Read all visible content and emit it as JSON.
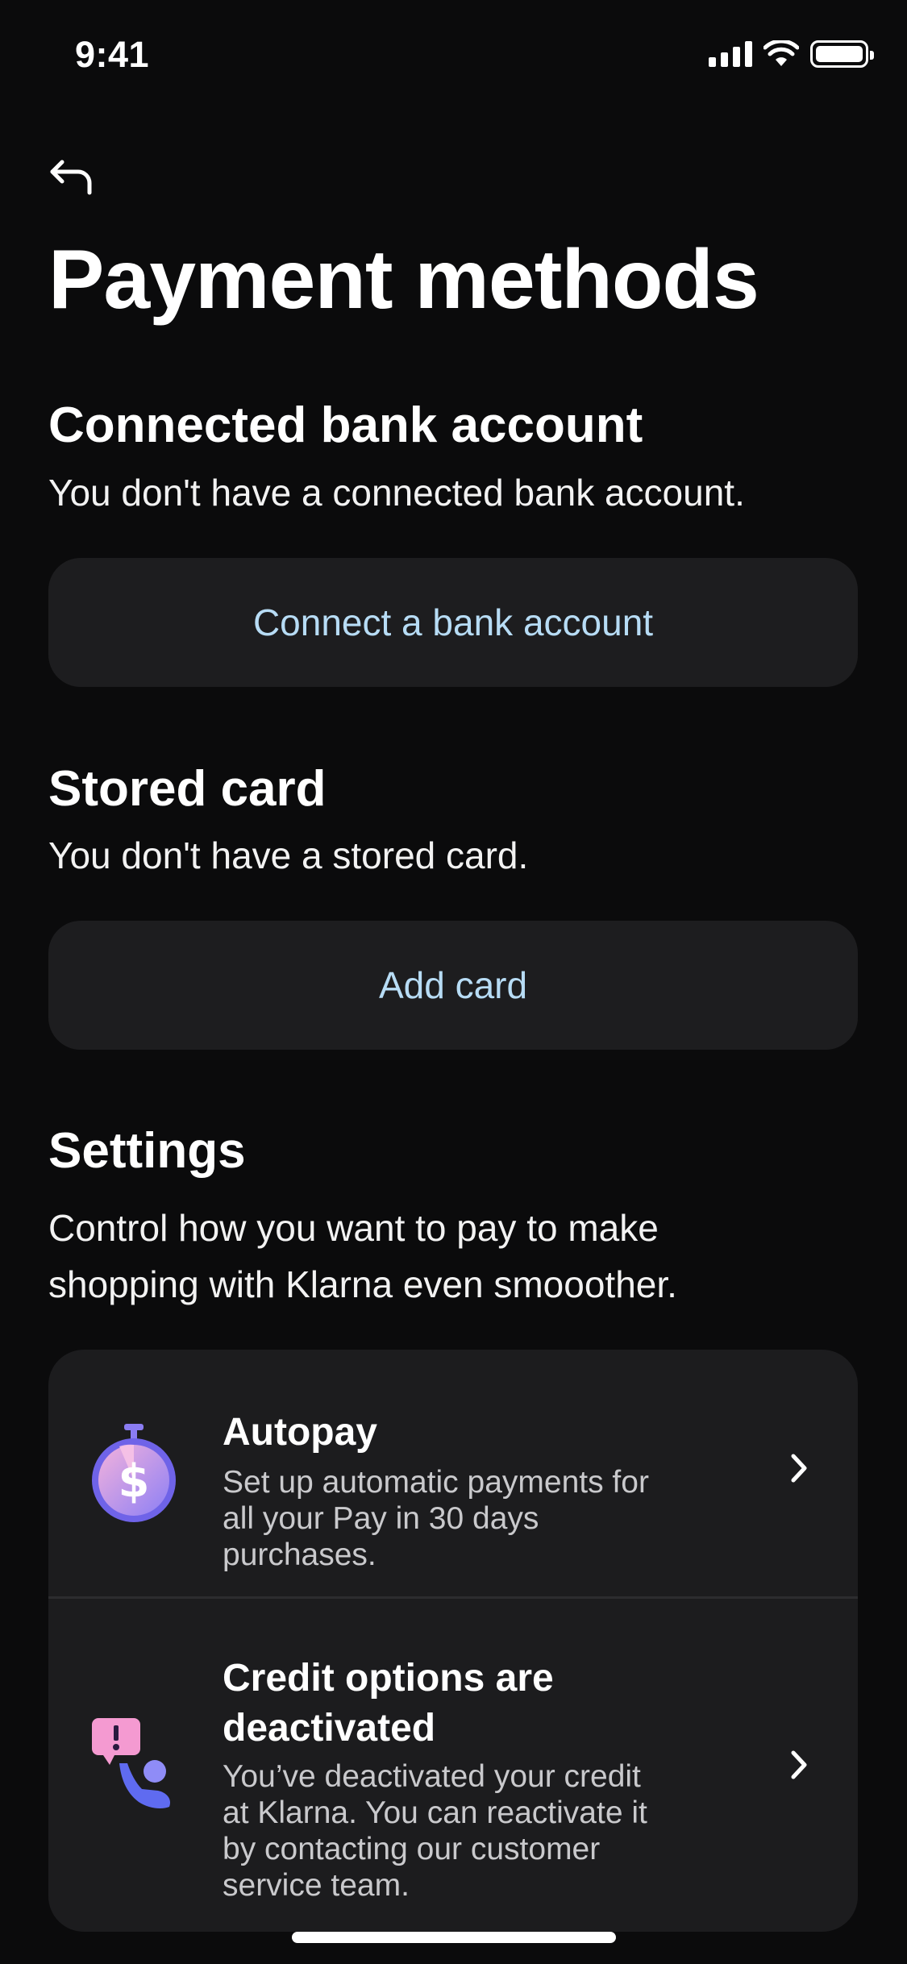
{
  "status_bar": {
    "time": "9:41"
  },
  "page": {
    "title": "Payment methods"
  },
  "bank": {
    "title": "Connected bank account",
    "description": "You don't have a connected bank account.",
    "button_label": "Connect a bank account"
  },
  "card": {
    "title": "Stored card",
    "description": "You don't have a stored card.",
    "button_label": "Add card"
  },
  "settings": {
    "title": "Settings",
    "description_line1": "Control how you want to pay to make",
    "description_line2": "shopping with Klarna even smooother.",
    "items": [
      {
        "icon": "autopay-stopwatch-dollar-icon",
        "title": "Autopay",
        "desc_lines": [
          "Set up automatic payments for",
          "all your Pay in 30 days",
          "purchases."
        ]
      },
      {
        "icon": "credit-alert-person-icon",
        "title_lines": [
          "Credit options are",
          "deactivated"
        ],
        "desc_lines": [
          "You’ve deactivated your credit",
          "at Klarna. You can reactivate it",
          "by contacting our customer",
          "service team."
        ]
      }
    ]
  },
  "colors": {
    "background": "#0b0b0c",
    "card": "#1c1c1e",
    "link": "#b7dcf5",
    "icon_purple": "#8a7cf2",
    "icon_pink": "#f49ad1"
  }
}
